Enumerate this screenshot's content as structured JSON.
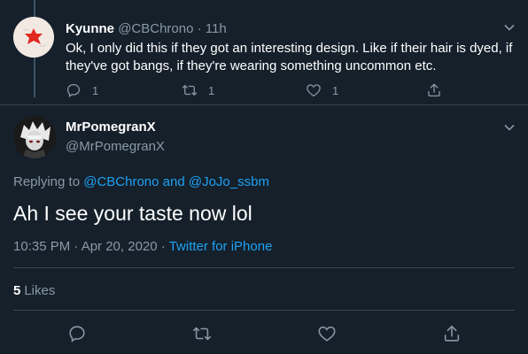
{
  "reply_tweet": {
    "display_name": "Kyunne",
    "handle": "@CBChrono",
    "separator": "·",
    "time": "11h",
    "text": "Ok, I only did this if they got an interesting design. Like if their hair is dyed, if they've got bangs, if they're wearing something uncommon etc.",
    "reply_count": "1",
    "retweet_count": "1",
    "like_count": "1"
  },
  "main_tweet": {
    "display_name": "MrPomegranX",
    "handle": "@MrPomegranX",
    "replying_prefix": "Replying to",
    "replying_user1": "@CBChrono",
    "replying_and": "and",
    "replying_user2": "@JoJo_ssbm",
    "text": "Ah I see your taste now lol",
    "timestamp": "10:35 PM · Apr 20, 2020",
    "meta_separator": "·",
    "source": "Twitter for iPhone",
    "likes_count": "5",
    "likes_label": "Likes"
  },
  "colors": {
    "background": "#15202b",
    "muted_text": "#8899a6",
    "link": "#1da1f2",
    "divider": "#38444d"
  }
}
